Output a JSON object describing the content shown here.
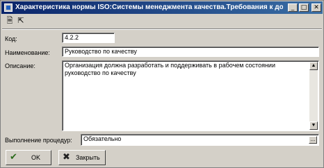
{
  "window": {
    "title": "Характеристика нормы ISO:Системы менеджмента качества.Требования к доку...",
    "minimize_glyph": "_",
    "maximize_glyph": "□",
    "close_glyph": "✕"
  },
  "toolbar": {
    "icons": [
      "document-icon",
      "pointer-help-icon"
    ]
  },
  "form": {
    "code_label": "Код:",
    "code_value": "4.2.2",
    "name_label": "Наименование:",
    "name_value": "Руководство по качеству",
    "description_label": "Описание:",
    "description_value": "Организация должна разработать и поддерживать в рабочем состоянии руководство по качеству",
    "procedure_label": "Выполнение процедур:",
    "procedure_value": "Обязательно"
  },
  "buttons": {
    "ok_label": "OK",
    "close_label": "Закрыть"
  },
  "colors": {
    "titlebar_start": "#0a246a",
    "titlebar_end": "#3a6ea5",
    "face": "#d4d0c8"
  }
}
